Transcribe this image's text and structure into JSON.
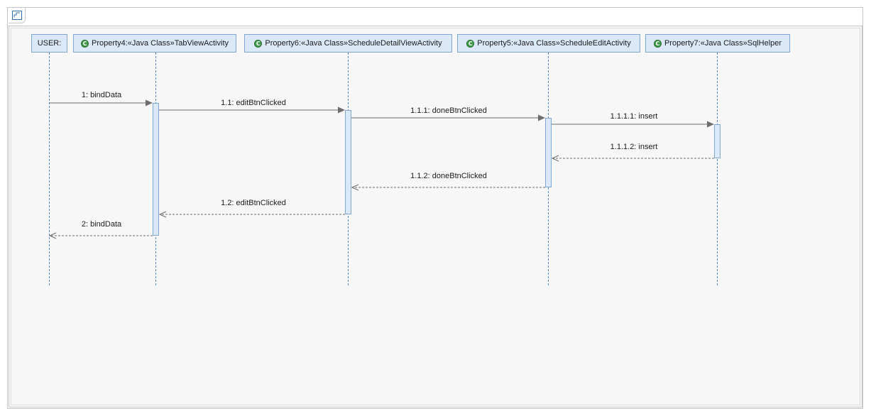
{
  "lifelines": [
    {
      "name": "USER:",
      "has_class_icon": false
    },
    {
      "name": "Property4:«Java Class»TabViewActivity",
      "has_class_icon": true,
      "icon_name": "java-class-icon",
      "icon_letter": "C"
    },
    {
      "name": "Property6:«Java Class»ScheduleDetailViewActivity",
      "has_class_icon": true,
      "icon_name": "java-class-icon",
      "icon_letter": "C"
    },
    {
      "name": "Property5:«Java Class»ScheduleEditActivity",
      "has_class_icon": true,
      "icon_name": "java-class-icon",
      "icon_letter": "C"
    },
    {
      "name": "Property7:«Java Class»SqlHelper",
      "has_class_icon": true,
      "icon_name": "java-class-icon",
      "icon_letter": "C"
    }
  ],
  "messages": [
    {
      "label": "1: bindData",
      "from": 0,
      "to": 1,
      "kind": "call"
    },
    {
      "label": "1.1: editBtnClicked",
      "from": 1,
      "to": 2,
      "kind": "call"
    },
    {
      "label": "1.1.1: doneBtnClicked",
      "from": 2,
      "to": 3,
      "kind": "call"
    },
    {
      "label": "1.1.1.1: insert",
      "from": 3,
      "to": 4,
      "kind": "call"
    },
    {
      "label": "1.1.1.2: insert",
      "from": 4,
      "to": 3,
      "kind": "return"
    },
    {
      "label": "1.1.2: doneBtnClicked",
      "from": 3,
      "to": 2,
      "kind": "return"
    },
    {
      "label": "1.2: editBtnClicked",
      "from": 2,
      "to": 1,
      "kind": "return"
    },
    {
      "label": "2: bindData",
      "from": 1,
      "to": 0,
      "kind": "return"
    }
  ],
  "colors": {
    "lifeline_fill": "#dbe8f7",
    "lifeline_border": "#7fa7d1",
    "lifeline_dash": "#4f86c6",
    "arrow": "#6e6e6e",
    "class_icon": "#3f9a4a",
    "canvas": "#f7f7f7"
  },
  "frame_icon": "diagram-frame-icon"
}
